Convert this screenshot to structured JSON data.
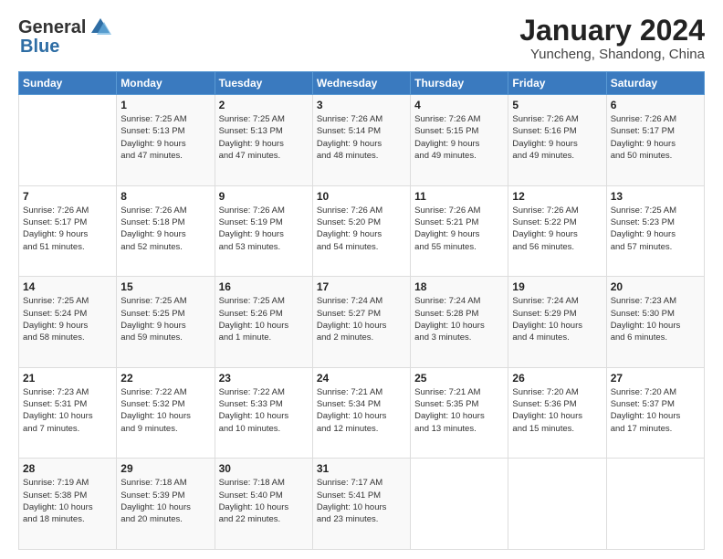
{
  "logo": {
    "general": "General",
    "blue": "Blue"
  },
  "title": "January 2024",
  "location": "Yuncheng, Shandong, China",
  "days_of_week": [
    "Sunday",
    "Monday",
    "Tuesday",
    "Wednesday",
    "Thursday",
    "Friday",
    "Saturday"
  ],
  "weeks": [
    [
      {
        "day": "",
        "info": ""
      },
      {
        "day": "1",
        "info": "Sunrise: 7:25 AM\nSunset: 5:13 PM\nDaylight: 9 hours\nand 47 minutes."
      },
      {
        "day": "2",
        "info": "Sunrise: 7:25 AM\nSunset: 5:13 PM\nDaylight: 9 hours\nand 47 minutes."
      },
      {
        "day": "3",
        "info": "Sunrise: 7:26 AM\nSunset: 5:14 PM\nDaylight: 9 hours\nand 48 minutes."
      },
      {
        "day": "4",
        "info": "Sunrise: 7:26 AM\nSunset: 5:15 PM\nDaylight: 9 hours\nand 49 minutes."
      },
      {
        "day": "5",
        "info": "Sunrise: 7:26 AM\nSunset: 5:16 PM\nDaylight: 9 hours\nand 49 minutes."
      },
      {
        "day": "6",
        "info": "Sunrise: 7:26 AM\nSunset: 5:17 PM\nDaylight: 9 hours\nand 50 minutes."
      }
    ],
    [
      {
        "day": "7",
        "info": "Sunrise: 7:26 AM\nSunset: 5:17 PM\nDaylight: 9 hours\nand 51 minutes."
      },
      {
        "day": "8",
        "info": "Sunrise: 7:26 AM\nSunset: 5:18 PM\nDaylight: 9 hours\nand 52 minutes."
      },
      {
        "day": "9",
        "info": "Sunrise: 7:26 AM\nSunset: 5:19 PM\nDaylight: 9 hours\nand 53 minutes."
      },
      {
        "day": "10",
        "info": "Sunrise: 7:26 AM\nSunset: 5:20 PM\nDaylight: 9 hours\nand 54 minutes."
      },
      {
        "day": "11",
        "info": "Sunrise: 7:26 AM\nSunset: 5:21 PM\nDaylight: 9 hours\nand 55 minutes."
      },
      {
        "day": "12",
        "info": "Sunrise: 7:26 AM\nSunset: 5:22 PM\nDaylight: 9 hours\nand 56 minutes."
      },
      {
        "day": "13",
        "info": "Sunrise: 7:25 AM\nSunset: 5:23 PM\nDaylight: 9 hours\nand 57 minutes."
      }
    ],
    [
      {
        "day": "14",
        "info": "Sunrise: 7:25 AM\nSunset: 5:24 PM\nDaylight: 9 hours\nand 58 minutes."
      },
      {
        "day": "15",
        "info": "Sunrise: 7:25 AM\nSunset: 5:25 PM\nDaylight: 9 hours\nand 59 minutes."
      },
      {
        "day": "16",
        "info": "Sunrise: 7:25 AM\nSunset: 5:26 PM\nDaylight: 10 hours\nand 1 minute."
      },
      {
        "day": "17",
        "info": "Sunrise: 7:24 AM\nSunset: 5:27 PM\nDaylight: 10 hours\nand 2 minutes."
      },
      {
        "day": "18",
        "info": "Sunrise: 7:24 AM\nSunset: 5:28 PM\nDaylight: 10 hours\nand 3 minutes."
      },
      {
        "day": "19",
        "info": "Sunrise: 7:24 AM\nSunset: 5:29 PM\nDaylight: 10 hours\nand 4 minutes."
      },
      {
        "day": "20",
        "info": "Sunrise: 7:23 AM\nSunset: 5:30 PM\nDaylight: 10 hours\nand 6 minutes."
      }
    ],
    [
      {
        "day": "21",
        "info": "Sunrise: 7:23 AM\nSunset: 5:31 PM\nDaylight: 10 hours\nand 7 minutes."
      },
      {
        "day": "22",
        "info": "Sunrise: 7:22 AM\nSunset: 5:32 PM\nDaylight: 10 hours\nand 9 minutes."
      },
      {
        "day": "23",
        "info": "Sunrise: 7:22 AM\nSunset: 5:33 PM\nDaylight: 10 hours\nand 10 minutes."
      },
      {
        "day": "24",
        "info": "Sunrise: 7:21 AM\nSunset: 5:34 PM\nDaylight: 10 hours\nand 12 minutes."
      },
      {
        "day": "25",
        "info": "Sunrise: 7:21 AM\nSunset: 5:35 PM\nDaylight: 10 hours\nand 13 minutes."
      },
      {
        "day": "26",
        "info": "Sunrise: 7:20 AM\nSunset: 5:36 PM\nDaylight: 10 hours\nand 15 minutes."
      },
      {
        "day": "27",
        "info": "Sunrise: 7:20 AM\nSunset: 5:37 PM\nDaylight: 10 hours\nand 17 minutes."
      }
    ],
    [
      {
        "day": "28",
        "info": "Sunrise: 7:19 AM\nSunset: 5:38 PM\nDaylight: 10 hours\nand 18 minutes."
      },
      {
        "day": "29",
        "info": "Sunrise: 7:18 AM\nSunset: 5:39 PM\nDaylight: 10 hours\nand 20 minutes."
      },
      {
        "day": "30",
        "info": "Sunrise: 7:18 AM\nSunset: 5:40 PM\nDaylight: 10 hours\nand 22 minutes."
      },
      {
        "day": "31",
        "info": "Sunrise: 7:17 AM\nSunset: 5:41 PM\nDaylight: 10 hours\nand 23 minutes."
      },
      {
        "day": "",
        "info": ""
      },
      {
        "day": "",
        "info": ""
      },
      {
        "day": "",
        "info": ""
      }
    ]
  ]
}
